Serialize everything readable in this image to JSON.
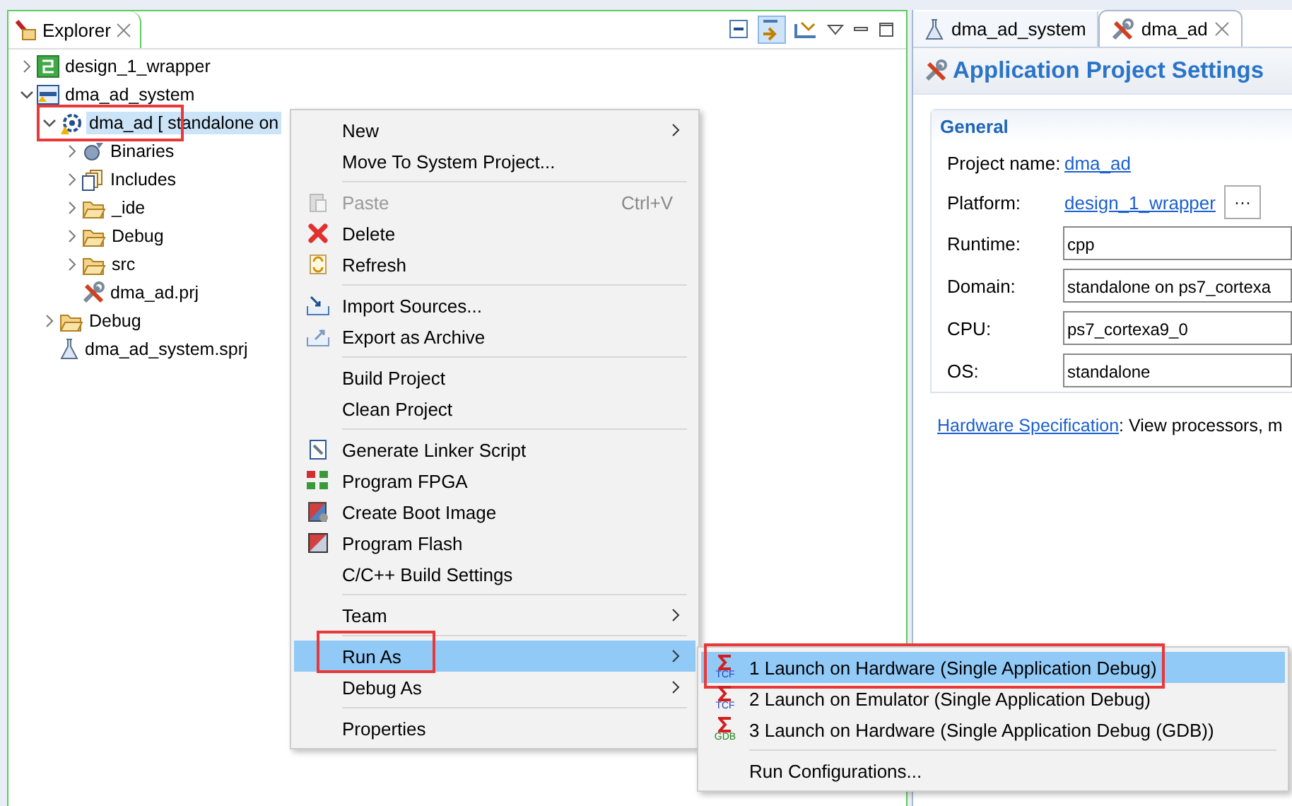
{
  "explorer": {
    "title": "Explorer",
    "tree": [
      {
        "label": "design_1_wrapper",
        "kind": "platform",
        "expanded": false,
        "selected": false
      },
      {
        "label": "dma_ad_system",
        "kind": "system",
        "expanded": true,
        "selected": false,
        "children": [
          {
            "label": "dma_ad [ standalone on",
            "kind": "app",
            "expanded": true,
            "selected": true,
            "annotated": true,
            "children": [
              {
                "label": "Binaries",
                "kind": "binaries",
                "expanded": false,
                "selected": false
              },
              {
                "label": "Includes",
                "kind": "includes",
                "expanded": false,
                "selected": false
              },
              {
                "label": "_ide",
                "kind": "folder",
                "expanded": false,
                "selected": false
              },
              {
                "label": "Debug",
                "kind": "folder",
                "expanded": false,
                "selected": false
              },
              {
                "label": "src",
                "kind": "folder",
                "expanded": false,
                "selected": false
              },
              {
                "label": "dma_ad.prj",
                "kind": "tools",
                "selected": false
              }
            ]
          },
          {
            "label": "Debug",
            "kind": "folder",
            "expanded": false,
            "selected": false
          },
          {
            "label": "dma_ad_system.sprj",
            "kind": "flask",
            "selected": false
          }
        ]
      }
    ]
  },
  "context_menu": {
    "items": [
      {
        "kind": "item",
        "label": "New",
        "submenu": true,
        "selected": false,
        "disabled": false
      },
      {
        "kind": "item",
        "label": "Move To System Project...",
        "selected": false,
        "disabled": false
      },
      {
        "kind": "separator"
      },
      {
        "kind": "item",
        "label": "Paste",
        "shortcut": "Ctrl+V",
        "selected": false,
        "disabled": true
      },
      {
        "kind": "item",
        "label": "Delete",
        "selected": false,
        "disabled": false
      },
      {
        "kind": "item",
        "label": "Refresh",
        "selected": false,
        "disabled": false
      },
      {
        "kind": "separator"
      },
      {
        "kind": "item",
        "label": "Import Sources...",
        "selected": false,
        "disabled": false
      },
      {
        "kind": "item",
        "label": "Export as Archive",
        "selected": false,
        "disabled": false
      },
      {
        "kind": "separator"
      },
      {
        "kind": "item",
        "label": "Build Project",
        "selected": false,
        "disabled": false
      },
      {
        "kind": "item",
        "label": "Clean Project",
        "selected": false,
        "disabled": false
      },
      {
        "kind": "separator"
      },
      {
        "kind": "item",
        "label": "Generate Linker Script",
        "selected": false,
        "disabled": false
      },
      {
        "kind": "item",
        "label": "Program FPGA",
        "selected": false,
        "disabled": false
      },
      {
        "kind": "item",
        "label": "Create Boot Image",
        "selected": false,
        "disabled": false
      },
      {
        "kind": "item",
        "label": "Program Flash",
        "selected": false,
        "disabled": false
      },
      {
        "kind": "item",
        "label": "C/C++ Build Settings",
        "selected": false,
        "disabled": false
      },
      {
        "kind": "separator"
      },
      {
        "kind": "item",
        "label": "Team",
        "submenu": true,
        "selected": false,
        "disabled": false
      },
      {
        "kind": "separator"
      },
      {
        "kind": "item",
        "label": "Run As",
        "submenu": true,
        "selected": true,
        "annotated": true,
        "disabled": false
      },
      {
        "kind": "item",
        "label": "Debug As",
        "submenu": true,
        "selected": false,
        "disabled": false
      },
      {
        "kind": "separator"
      },
      {
        "kind": "item",
        "label": "Properties",
        "selected": false,
        "disabled": false
      }
    ]
  },
  "submenu": {
    "items": [
      {
        "kind": "item",
        "label": "1 Launch on Hardware (Single Application Debug)",
        "badge": "TCF",
        "selected": true,
        "annotated": true
      },
      {
        "kind": "item",
        "label": "2 Launch on Emulator (Single Application Debug)",
        "badge": "TCF",
        "selected": false
      },
      {
        "kind": "item",
        "label": "3 Launch on Hardware (Single Application Debug (GDB))",
        "badge": "GDB",
        "selected": false
      },
      {
        "kind": "separator"
      },
      {
        "kind": "item",
        "label": "Run Configurations...",
        "selected": false
      }
    ]
  },
  "editor": {
    "tabs": [
      {
        "label": "dma_ad_system",
        "kind": "flask",
        "selected": false
      },
      {
        "label": "dma_ad",
        "kind": "tools",
        "selected": true
      }
    ],
    "title": "Application Project Settings",
    "section": "General",
    "fields": [
      {
        "label": "Project name:",
        "kind": "link",
        "value": "dma_ad"
      },
      {
        "label": "Platform:",
        "kind": "link-browse",
        "value": "design_1_wrapper",
        "button": "···"
      },
      {
        "label": "Runtime:",
        "kind": "input",
        "value": "cpp"
      },
      {
        "label": "Domain:",
        "kind": "input",
        "value": "standalone on ps7_cortexa"
      },
      {
        "label": "CPU:",
        "kind": "input",
        "value": "ps7_cortexa9_0"
      },
      {
        "label": "OS:",
        "kind": "input",
        "value": "standalone"
      }
    ],
    "footer": {
      "link": "Hardware Specification",
      "text": ": View processors, m"
    }
  }
}
